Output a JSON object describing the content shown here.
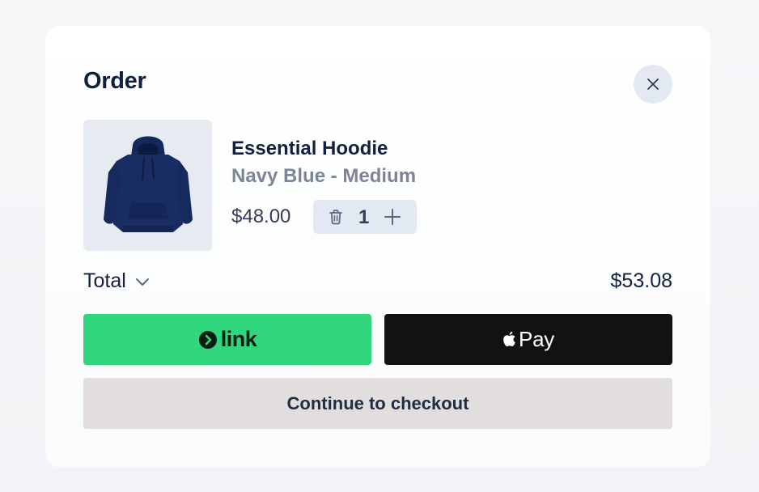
{
  "order": {
    "title": "Order"
  },
  "product": {
    "name": "Essential Hoodie",
    "variant": "Navy Blue - Medium",
    "price": "$48.00",
    "quantity": "1",
    "image_icon": "hoodie-image",
    "image_color": "#15285a"
  },
  "total": {
    "label": "Total",
    "amount": "$53.08"
  },
  "buttons": {
    "link_label": "link",
    "applepay_label": "Pay",
    "checkout_label": "Continue to checkout"
  },
  "colors": {
    "link_green": "#2fd67b",
    "applepay_black": "#111214",
    "checkout_bg": "#e1dedd",
    "text_primary": "#0f2140",
    "text_secondary": "#7a8597"
  },
  "icons": {
    "close": "close-icon",
    "trash": "trash-icon",
    "plus": "plus-icon",
    "chevron": "chevron-down-icon",
    "link": "link-logo-icon",
    "apple": "apple-logo-icon"
  }
}
